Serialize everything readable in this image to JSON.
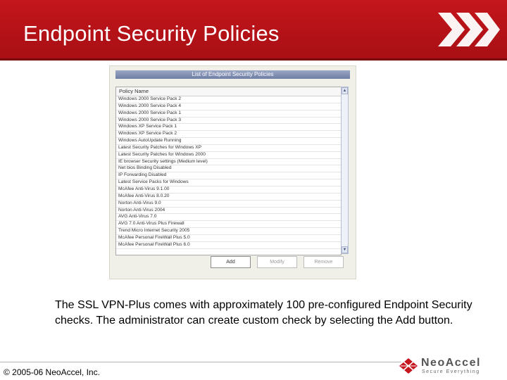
{
  "slide": {
    "title": "Endpoint Security Policies",
    "caption": "The SSL VPN-Plus comes with approximately 100 pre-configured Endpoint Security checks. The administrator can create custom check by selecting the Add button.",
    "copyright": "© 2005-06 NeoAccel, Inc."
  },
  "logo": {
    "name": "NeoAccel",
    "tagline": "Secure Everything"
  },
  "dialog": {
    "title": "List of Endpoint Security Policies",
    "column_header": "Policy Name",
    "items": [
      "Windows 2000 Service Pack 2",
      "Windows 2000 Service Pack 4",
      "Windows 2000 Service Pack 1",
      "Windows 2000 Service Pack 3",
      "Windows XP Service Pack 1",
      "Windows XP Service Pack 2",
      "Windows AutoUpdate Running",
      "Latest Security Patches for Windows XP",
      "Latest Security Patches for Windows 2000",
      "IE browser Security settings (Medium level)",
      "Net bios Binding Disabled",
      "IP Forwarding Disabled",
      "Latest Service Packs for Windows",
      "McAfee Anti-Virus 9.1.00",
      "McAfee Anti-Virus 8.0.20",
      "Norton Anti-Virus 9.0",
      "Norton Anti-Virus 2004",
      "AVG Anti-Virus 7.0",
      "AVG 7.0 Anti-Virus Plus Firewall",
      "Trend Micro Internet Security 2005",
      "McAfee Personal FireWall Plus 5.0",
      "McAfee Personal FireWall Plus 6.0"
    ],
    "buttons": {
      "add": "Add",
      "modify": "Modify",
      "remove": "Remove"
    }
  },
  "colors": {
    "header_red": "#c4161c",
    "text_black": "#000000",
    "panel_gray": "#f0efe8"
  }
}
